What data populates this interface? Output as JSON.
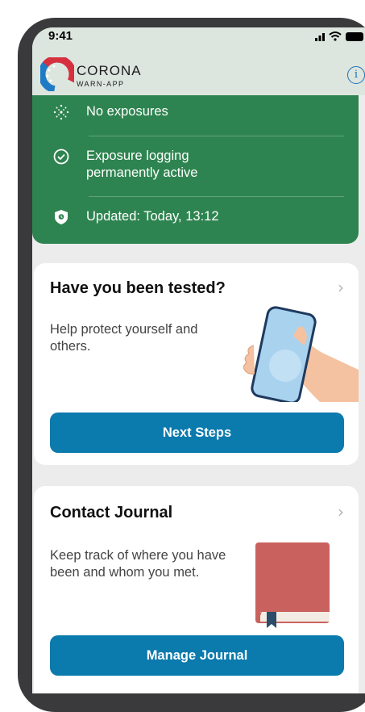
{
  "status_bar": {
    "time": "9:41"
  },
  "header": {
    "brand_name": "CORONA",
    "brand_sub": "WARN-APP",
    "info_glyph": "i",
    "colors": {
      "header_bg": "#dde5df",
      "accent": "#1b72b8"
    }
  },
  "risk_card": {
    "color": "#2e8450",
    "rows": [
      {
        "icon": "virus-icon",
        "text": "No exposures"
      },
      {
        "icon": "check-circle-icon",
        "text": "Exposure logging permanently active"
      },
      {
        "icon": "shield-icon",
        "text": "Updated: Today, 13:12"
      }
    ]
  },
  "test_card": {
    "title": "Have you been tested?",
    "body": "Help protect yourself and others.",
    "button_label": "Next Steps",
    "illustration": "hand-holding-phone-illustration"
  },
  "journal_card": {
    "title": "Contact Journal",
    "body": "Keep track of where you have been and whom you met.",
    "button_label": "Manage Journal",
    "illustration": "book-illustration"
  },
  "colors": {
    "button": "#0b7aad",
    "screen_bg": "#ececec"
  }
}
